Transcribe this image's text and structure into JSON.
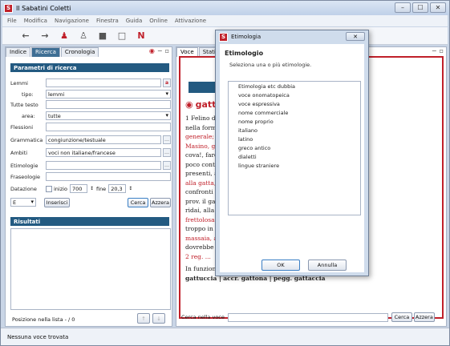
{
  "window": {
    "title": "Il Sabatini Coletti",
    "min_btn": "–",
    "max_btn": "☐",
    "close_btn": "✕"
  },
  "menu": [
    "File",
    "Modifica",
    "Navigazione",
    "Finestra",
    "Guida",
    "Online",
    "Attivazione"
  ],
  "toolbar": {
    "icons": [
      "arrow-left-icon",
      "arrow-right-icon",
      "person-icon",
      "person-outline-icon",
      "bookmark-icon",
      "bookmark-outline-icon",
      "n-logo-icon"
    ],
    "n_label": "N"
  },
  "left": {
    "tabs": [
      "Indice",
      "Ricerca",
      "Cronologia"
    ],
    "params_header": "Parametri di ricerca",
    "labels": {
      "lemmi": "Lemmi",
      "tipo": "tipo:",
      "tutte_testo": "Tutte testo",
      "area": "area:",
      "flessioni": "Flessioni",
      "grammatica": "Grammatica",
      "ambiti": "Ambiti",
      "etimologie": "Etimologie",
      "fraseologie": "Fraseologie",
      "datazione": "Datazione",
      "inizio": "inizio",
      "fine": "fine"
    },
    "values": {
      "tipo": "lemmi",
      "area": "tutte",
      "grammatica": "congiunzione/testuale",
      "ambiti": "voci non italiane/francese",
      "inizio": "700",
      "fine": "20,3",
      "operator": "E"
    },
    "buttons": {
      "inserisci": "Inserisci",
      "cerca": "Cerca",
      "azzera": "Azzera"
    },
    "results_header": "Risultati",
    "position_label": "Posizione nella lista  - / 0"
  },
  "right": {
    "tabs": [
      "Voce",
      "Statistiche"
    ],
    "headword": "gatto",
    "content": {
      "l1": "1 Felino domestico, Felis cattus, e spec.",
      "l2": "nella forma domestica a pelo corto in",
      "l3": "generale; gatto selvatico, gatto di",
      "l4": "Masino, gatto soriano, gatto e",
      "l5": "cova!, fare il gatto, tanto va il gatto, di",
      "l6": "poco conto, senza esperienza che",
      "l7": "presenti, avere gli occhi, occhio",
      "l8": "alla gatta, essere di vigilanza nei",
      "l9": "confronti di uno, c'è un po' nei",
      "l10": "prov. il gatto, lo sfrontato, dai e",
      "l11": "ridai, alla fine, gatta frettolosa, la gatta",
      "l12": "frettolosa fa i gattini ciechi, fatte",
      "l13": "troppo in fretta, tanto va la gatta se la",
      "l14": "massaia, al lardo che ci lascia lo zampino, di chi",
      "l15": "dovrebbe essere",
      "l16": "2 reg. ...",
      "l17": "In funzione di agg. nella loc. a bo g, gattaia • dim. gattina,",
      "l18": "gattuccia | accr. gattona | pegg. gattaccia"
    },
    "search_label": "Cerca nella voce",
    "buttons": {
      "cerca": "Cerca",
      "azzera": "Azzera"
    }
  },
  "dialog": {
    "title": "Etimologia",
    "heading": "Etimologio",
    "subtitle": "Seleziona una o più etimologie.",
    "close": "✕",
    "items": [
      "Etimologia etc dubbia",
      "voce onomatopeica",
      "voce espressiva",
      "nome commerciale",
      "nome proprio",
      "italiano",
      "latino",
      "greco antico",
      "dialetti",
      "lingue straniere"
    ],
    "ok": "OK",
    "cancel": "Annulla"
  },
  "status": {
    "text": "Nessuna voce trovata"
  }
}
